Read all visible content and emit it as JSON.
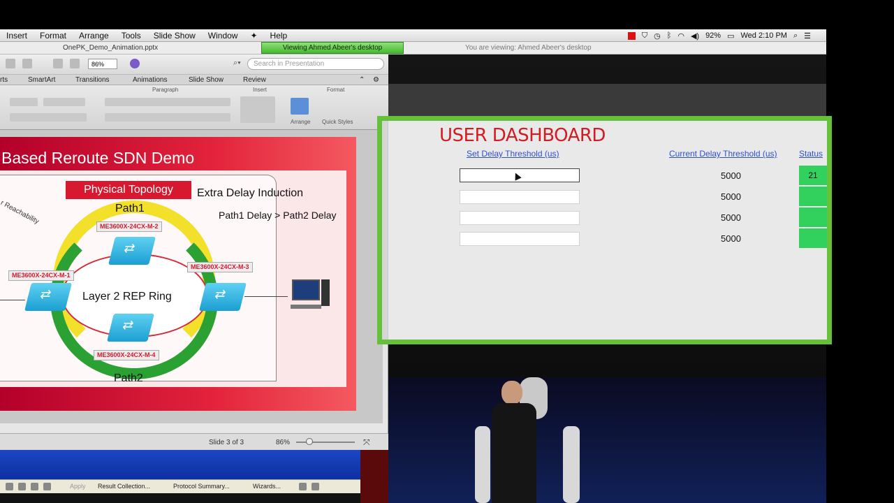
{
  "menubar": {
    "items": [
      "Insert",
      "Format",
      "Arrange",
      "Tools",
      "Slide Show",
      "Window",
      "Help"
    ],
    "battery": "92%",
    "clock": "Wed 2:10 PM"
  },
  "viewbar": {
    "file_name": "OnePK_Demo_Animation.pptx",
    "viewing_banner": "Viewing Ahmed Abeer's desktop",
    "you_are_viewing": "You are viewing: Ahmed Abeer's desktop"
  },
  "ppt": {
    "zoom_value": "86%",
    "search_placeholder": "Search in Presentation",
    "ribbon_tabs": [
      "rts",
      "SmartArt",
      "Transitions",
      "Animations",
      "Slide Show",
      "Review"
    ],
    "ribbon_groups": [
      "Paragraph",
      "Insert",
      "Format"
    ],
    "ribbon_buttons": [
      "Arrange",
      "Quick Styles"
    ],
    "status_slide": "Slide 3 of 3",
    "status_zoom": "86%"
  },
  "slide": {
    "title": "Based Reroute SDN Demo",
    "physical_topology": "Physical Topology",
    "path1": "Path1",
    "path2": "Path2",
    "extra_delay": "Extra Delay Induction",
    "path_compare": "Path1 Delay > Path2 Delay",
    "ring_label": "Layer 2 REP Ring",
    "reachability": "r Reachability",
    "nodes": [
      "ME3600X-24CX-M-2",
      "ME3600X-24CX-M-3",
      "ME3600X-24CX-M-1",
      "ME3600X-24CX-M-4"
    ]
  },
  "taskbar": {
    "items": [
      "Apply",
      "Result Collection...",
      "Protocol Summary...",
      "Wizards..."
    ]
  },
  "dashboard": {
    "title": "USER DASHBOARD",
    "set_header": "Set Delay Threshold (us)",
    "current_header": "Current Delay Threshold (us)",
    "status_header": "Status",
    "rows": [
      {
        "current": "5000",
        "status": "21"
      },
      {
        "current": "5000",
        "status": ""
      },
      {
        "current": "5000",
        "status": ""
      },
      {
        "current": "5000",
        "status": ""
      }
    ],
    "accent_color": "#65c13a",
    "title_color": "#d21c24"
  }
}
